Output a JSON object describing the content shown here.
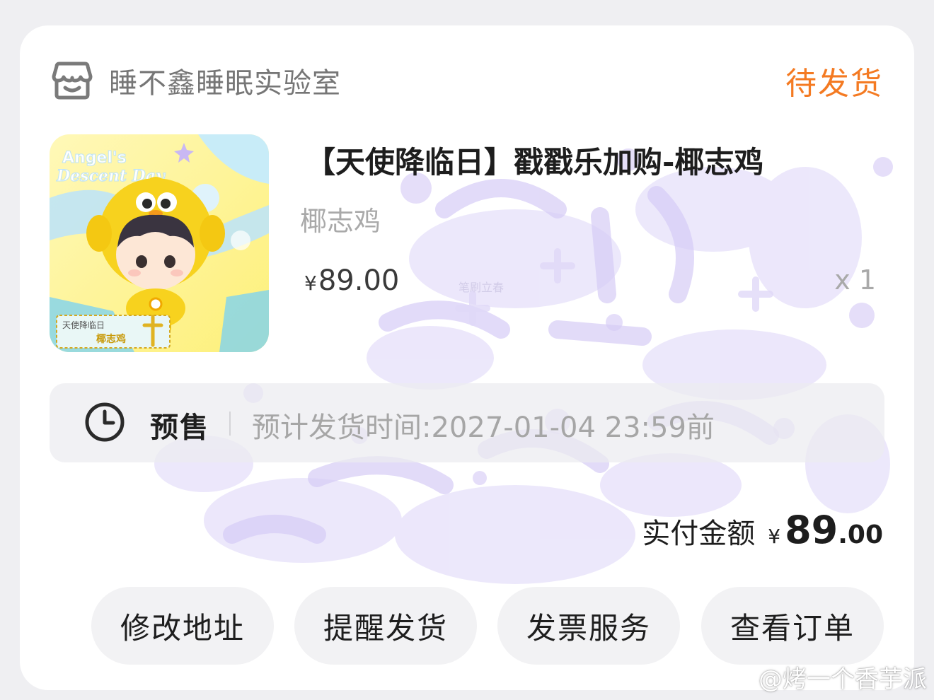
{
  "order": {
    "shop_name": "睡不鑫睡眠实验室",
    "status": "待发货",
    "product": {
      "title": "【天使降临日】戳戳乐加购-椰志鸡",
      "spec": "椰志鸡",
      "price_symbol": "¥",
      "price": "89.00",
      "quantity": "x 1",
      "thumb_text_line1": "Angel's",
      "thumb_text_line2": "Descent Day",
      "thumb_tag_line1": "天使降临日",
      "thumb_tag_line2": "椰志鸡"
    },
    "presale": {
      "label": "预售",
      "ship_time": "预计发货时间:2027-01-04 23:59前"
    },
    "payment": {
      "label": "实付金额",
      "symbol": "¥",
      "amount_int": "89",
      "amount_dec": ".00"
    },
    "actions": [
      {
        "label": "修改地址"
      },
      {
        "label": "提醒发货"
      },
      {
        "label": "发票服务"
      },
      {
        "label": "查看订单"
      }
    ]
  },
  "watermark": {
    "text": "@烤一个香芋派",
    "bg_text": "笔刷立春"
  },
  "colors": {
    "status_orange": "#f47a22",
    "watermark_purple": "#d9d2f4"
  }
}
